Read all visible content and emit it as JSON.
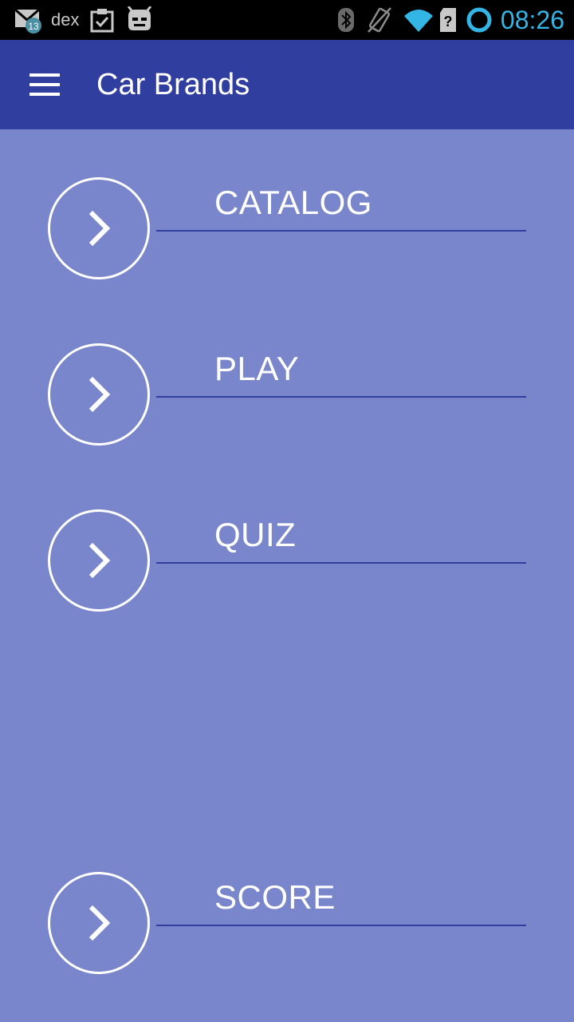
{
  "status_bar": {
    "left_icons": [
      "gmail-icon",
      "clipboard-check-icon",
      "cyanogenmod-icon"
    ],
    "gmail_badge": "13",
    "carrier_text": "dex",
    "right_icons": [
      "bluetooth-icon",
      "vibrate-icon",
      "wifi-icon",
      "sim-unknown-icon",
      "sync-ring-icon"
    ],
    "time": "08:26",
    "time_color": "#33b5e5"
  },
  "app_bar": {
    "menu_icon": "hamburger-menu-icon",
    "title": "Car Brands",
    "color": "#303f9f"
  },
  "background_color": "#7986cb",
  "menu": {
    "items": [
      {
        "label": "CATALOG",
        "icon": "chevron-right-icon"
      },
      {
        "label": "PLAY",
        "icon": "chevron-right-icon"
      },
      {
        "label": "QUIZ",
        "icon": "chevron-right-icon"
      },
      {
        "label": "SCORE",
        "icon": "chevron-right-icon"
      }
    ]
  }
}
